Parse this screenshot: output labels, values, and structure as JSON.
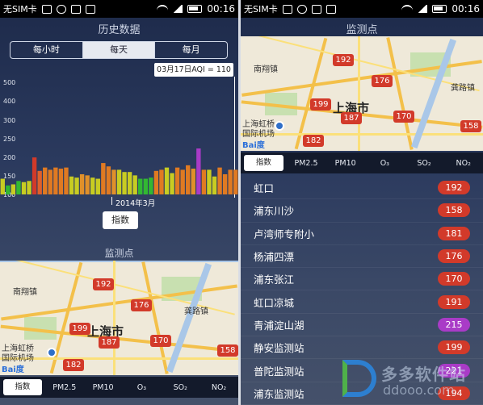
{
  "status": {
    "sim": "无SIM卡",
    "time": "00:16"
  },
  "left": {
    "title": "历史数据",
    "segments": [
      "每小时",
      "每天",
      "每月"
    ],
    "active_segment": 1,
    "tooltip": "03月17日AQI = 110",
    "x_label": "2014年3月",
    "metric_chip": "指数",
    "section_title": "监测点",
    "tabs": [
      "指数",
      "PM2.5",
      "PM10",
      "O₃",
      "SO₂",
      "NO₂"
    ]
  },
  "right": {
    "title": "监测点",
    "tabs": [
      "指数",
      "PM2.5",
      "PM10",
      "O₃",
      "SO₂",
      "NO₂"
    ],
    "stations": [
      {
        "name": "虹口",
        "value": "192",
        "color": "#d23a2a"
      },
      {
        "name": "浦东川沙",
        "value": "158",
        "color": "#d23a2a"
      },
      {
        "name": "卢湾师专附小",
        "value": "181",
        "color": "#d23a2a"
      },
      {
        "name": "杨浦四漂",
        "value": "176",
        "color": "#d23a2a"
      },
      {
        "name": "浦东张江",
        "value": "170",
        "color": "#d23a2a"
      },
      {
        "name": "虹口凉城",
        "value": "191",
        "color": "#d23a2a"
      },
      {
        "name": "青浦淀山湖",
        "value": "215",
        "color": "#a93bc7"
      },
      {
        "name": "静安监测站",
        "value": "199",
        "color": "#d23a2a"
      },
      {
        "name": "普陀监测站",
        "value": "221",
        "color": "#a93bc7"
      },
      {
        "name": "浦东监测站",
        "value": "194",
        "color": "#d23a2a"
      }
    ]
  },
  "map": {
    "city": "上海市",
    "labels": [
      "南翔镇",
      "龚路镇",
      "上海虹桥",
      "国际机场",
      "Bai度"
    ],
    "pins": [
      "192",
      "176",
      "199",
      "187",
      "170",
      "182",
      "158"
    ]
  },
  "watermark": {
    "line1": "多多软件站",
    "line2": "ddooo.com"
  },
  "chart_data": {
    "type": "bar",
    "title": "",
    "xlabel": "2014年3月",
    "ylabel": "",
    "ylim": [
      0,
      500
    ],
    "yticks": [
      100,
      150,
      200,
      250,
      300,
      400,
      500
    ],
    "values": [
      70,
      40,
      45,
      60,
      55,
      60,
      165,
      105,
      120,
      110,
      120,
      115,
      120,
      80,
      75,
      90,
      85,
      75,
      70,
      140,
      125,
      110,
      110,
      100,
      100,
      85,
      70,
      70,
      75,
      105,
      110,
      120,
      95,
      120,
      110,
      130,
      115,
      205,
      110,
      110,
      80,
      120,
      90,
      110,
      110
    ],
    "colors": [
      "#c8cc22",
      "#32b832",
      "#c8cc22",
      "#32b832",
      "#c8cc22",
      "#c8cc22",
      "#d23a2a",
      "#e0602a",
      "#e07a22",
      "#e07a22",
      "#e07a22",
      "#e07a22",
      "#e07a22",
      "#c8cc22",
      "#c8cc22",
      "#e0902a",
      "#e0902a",
      "#c8cc22",
      "#c8cc22",
      "#e07a22",
      "#e07a22",
      "#e0902a",
      "#c8cc22",
      "#c8cc22",
      "#c8cc22",
      "#c8cc22",
      "#32b832",
      "#32b832",
      "#32b832",
      "#e07a22",
      "#e07a22",
      "#c8cc22",
      "#c8cc22",
      "#e07a22",
      "#e07a22",
      "#e07a22",
      "#e0902a",
      "#a93bc7",
      "#e07a22",
      "#c8cc22",
      "#c8cc22",
      "#e07a22",
      "#e07a22",
      "#e07a22",
      "#e07a22"
    ]
  }
}
